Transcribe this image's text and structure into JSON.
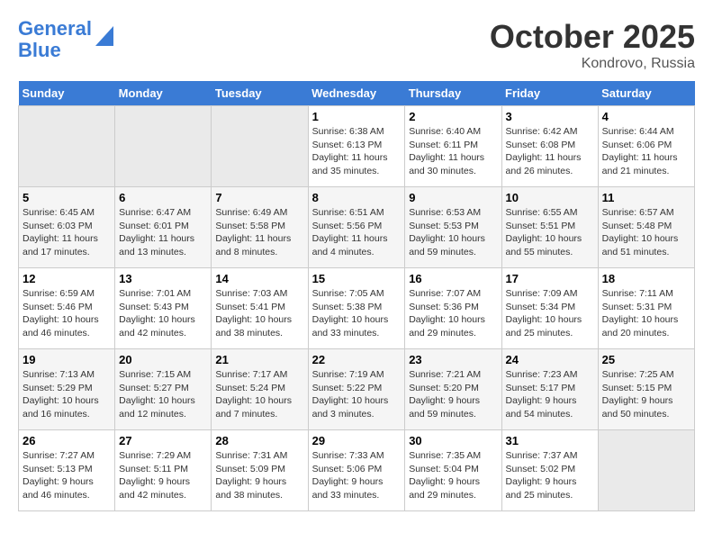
{
  "header": {
    "logo_line1": "General",
    "logo_line2": "Blue",
    "month": "October 2025",
    "location": "Kondrovo, Russia"
  },
  "days_of_week": [
    "Sunday",
    "Monday",
    "Tuesday",
    "Wednesday",
    "Thursday",
    "Friday",
    "Saturday"
  ],
  "weeks": [
    [
      {
        "day": "",
        "info": ""
      },
      {
        "day": "",
        "info": ""
      },
      {
        "day": "",
        "info": ""
      },
      {
        "day": "1",
        "info": "Sunrise: 6:38 AM\nSunset: 6:13 PM\nDaylight: 11 hours and 35 minutes."
      },
      {
        "day": "2",
        "info": "Sunrise: 6:40 AM\nSunset: 6:11 PM\nDaylight: 11 hours and 30 minutes."
      },
      {
        "day": "3",
        "info": "Sunrise: 6:42 AM\nSunset: 6:08 PM\nDaylight: 11 hours and 26 minutes."
      },
      {
        "day": "4",
        "info": "Sunrise: 6:44 AM\nSunset: 6:06 PM\nDaylight: 11 hours and 21 minutes."
      }
    ],
    [
      {
        "day": "5",
        "info": "Sunrise: 6:45 AM\nSunset: 6:03 PM\nDaylight: 11 hours and 17 minutes."
      },
      {
        "day": "6",
        "info": "Sunrise: 6:47 AM\nSunset: 6:01 PM\nDaylight: 11 hours and 13 minutes."
      },
      {
        "day": "7",
        "info": "Sunrise: 6:49 AM\nSunset: 5:58 PM\nDaylight: 11 hours and 8 minutes."
      },
      {
        "day": "8",
        "info": "Sunrise: 6:51 AM\nSunset: 5:56 PM\nDaylight: 11 hours and 4 minutes."
      },
      {
        "day": "9",
        "info": "Sunrise: 6:53 AM\nSunset: 5:53 PM\nDaylight: 10 hours and 59 minutes."
      },
      {
        "day": "10",
        "info": "Sunrise: 6:55 AM\nSunset: 5:51 PM\nDaylight: 10 hours and 55 minutes."
      },
      {
        "day": "11",
        "info": "Sunrise: 6:57 AM\nSunset: 5:48 PM\nDaylight: 10 hours and 51 minutes."
      }
    ],
    [
      {
        "day": "12",
        "info": "Sunrise: 6:59 AM\nSunset: 5:46 PM\nDaylight: 10 hours and 46 minutes."
      },
      {
        "day": "13",
        "info": "Sunrise: 7:01 AM\nSunset: 5:43 PM\nDaylight: 10 hours and 42 minutes."
      },
      {
        "day": "14",
        "info": "Sunrise: 7:03 AM\nSunset: 5:41 PM\nDaylight: 10 hours and 38 minutes."
      },
      {
        "day": "15",
        "info": "Sunrise: 7:05 AM\nSunset: 5:38 PM\nDaylight: 10 hours and 33 minutes."
      },
      {
        "day": "16",
        "info": "Sunrise: 7:07 AM\nSunset: 5:36 PM\nDaylight: 10 hours and 29 minutes."
      },
      {
        "day": "17",
        "info": "Sunrise: 7:09 AM\nSunset: 5:34 PM\nDaylight: 10 hours and 25 minutes."
      },
      {
        "day": "18",
        "info": "Sunrise: 7:11 AM\nSunset: 5:31 PM\nDaylight: 10 hours and 20 minutes."
      }
    ],
    [
      {
        "day": "19",
        "info": "Sunrise: 7:13 AM\nSunset: 5:29 PM\nDaylight: 10 hours and 16 minutes."
      },
      {
        "day": "20",
        "info": "Sunrise: 7:15 AM\nSunset: 5:27 PM\nDaylight: 10 hours and 12 minutes."
      },
      {
        "day": "21",
        "info": "Sunrise: 7:17 AM\nSunset: 5:24 PM\nDaylight: 10 hours and 7 minutes."
      },
      {
        "day": "22",
        "info": "Sunrise: 7:19 AM\nSunset: 5:22 PM\nDaylight: 10 hours and 3 minutes."
      },
      {
        "day": "23",
        "info": "Sunrise: 7:21 AM\nSunset: 5:20 PM\nDaylight: 9 hours and 59 minutes."
      },
      {
        "day": "24",
        "info": "Sunrise: 7:23 AM\nSunset: 5:17 PM\nDaylight: 9 hours and 54 minutes."
      },
      {
        "day": "25",
        "info": "Sunrise: 7:25 AM\nSunset: 5:15 PM\nDaylight: 9 hours and 50 minutes."
      }
    ],
    [
      {
        "day": "26",
        "info": "Sunrise: 7:27 AM\nSunset: 5:13 PM\nDaylight: 9 hours and 46 minutes."
      },
      {
        "day": "27",
        "info": "Sunrise: 7:29 AM\nSunset: 5:11 PM\nDaylight: 9 hours and 42 minutes."
      },
      {
        "day": "28",
        "info": "Sunrise: 7:31 AM\nSunset: 5:09 PM\nDaylight: 9 hours and 38 minutes."
      },
      {
        "day": "29",
        "info": "Sunrise: 7:33 AM\nSunset: 5:06 PM\nDaylight: 9 hours and 33 minutes."
      },
      {
        "day": "30",
        "info": "Sunrise: 7:35 AM\nSunset: 5:04 PM\nDaylight: 9 hours and 29 minutes."
      },
      {
        "day": "31",
        "info": "Sunrise: 7:37 AM\nSunset: 5:02 PM\nDaylight: 9 hours and 25 minutes."
      },
      {
        "day": "",
        "info": ""
      }
    ]
  ]
}
